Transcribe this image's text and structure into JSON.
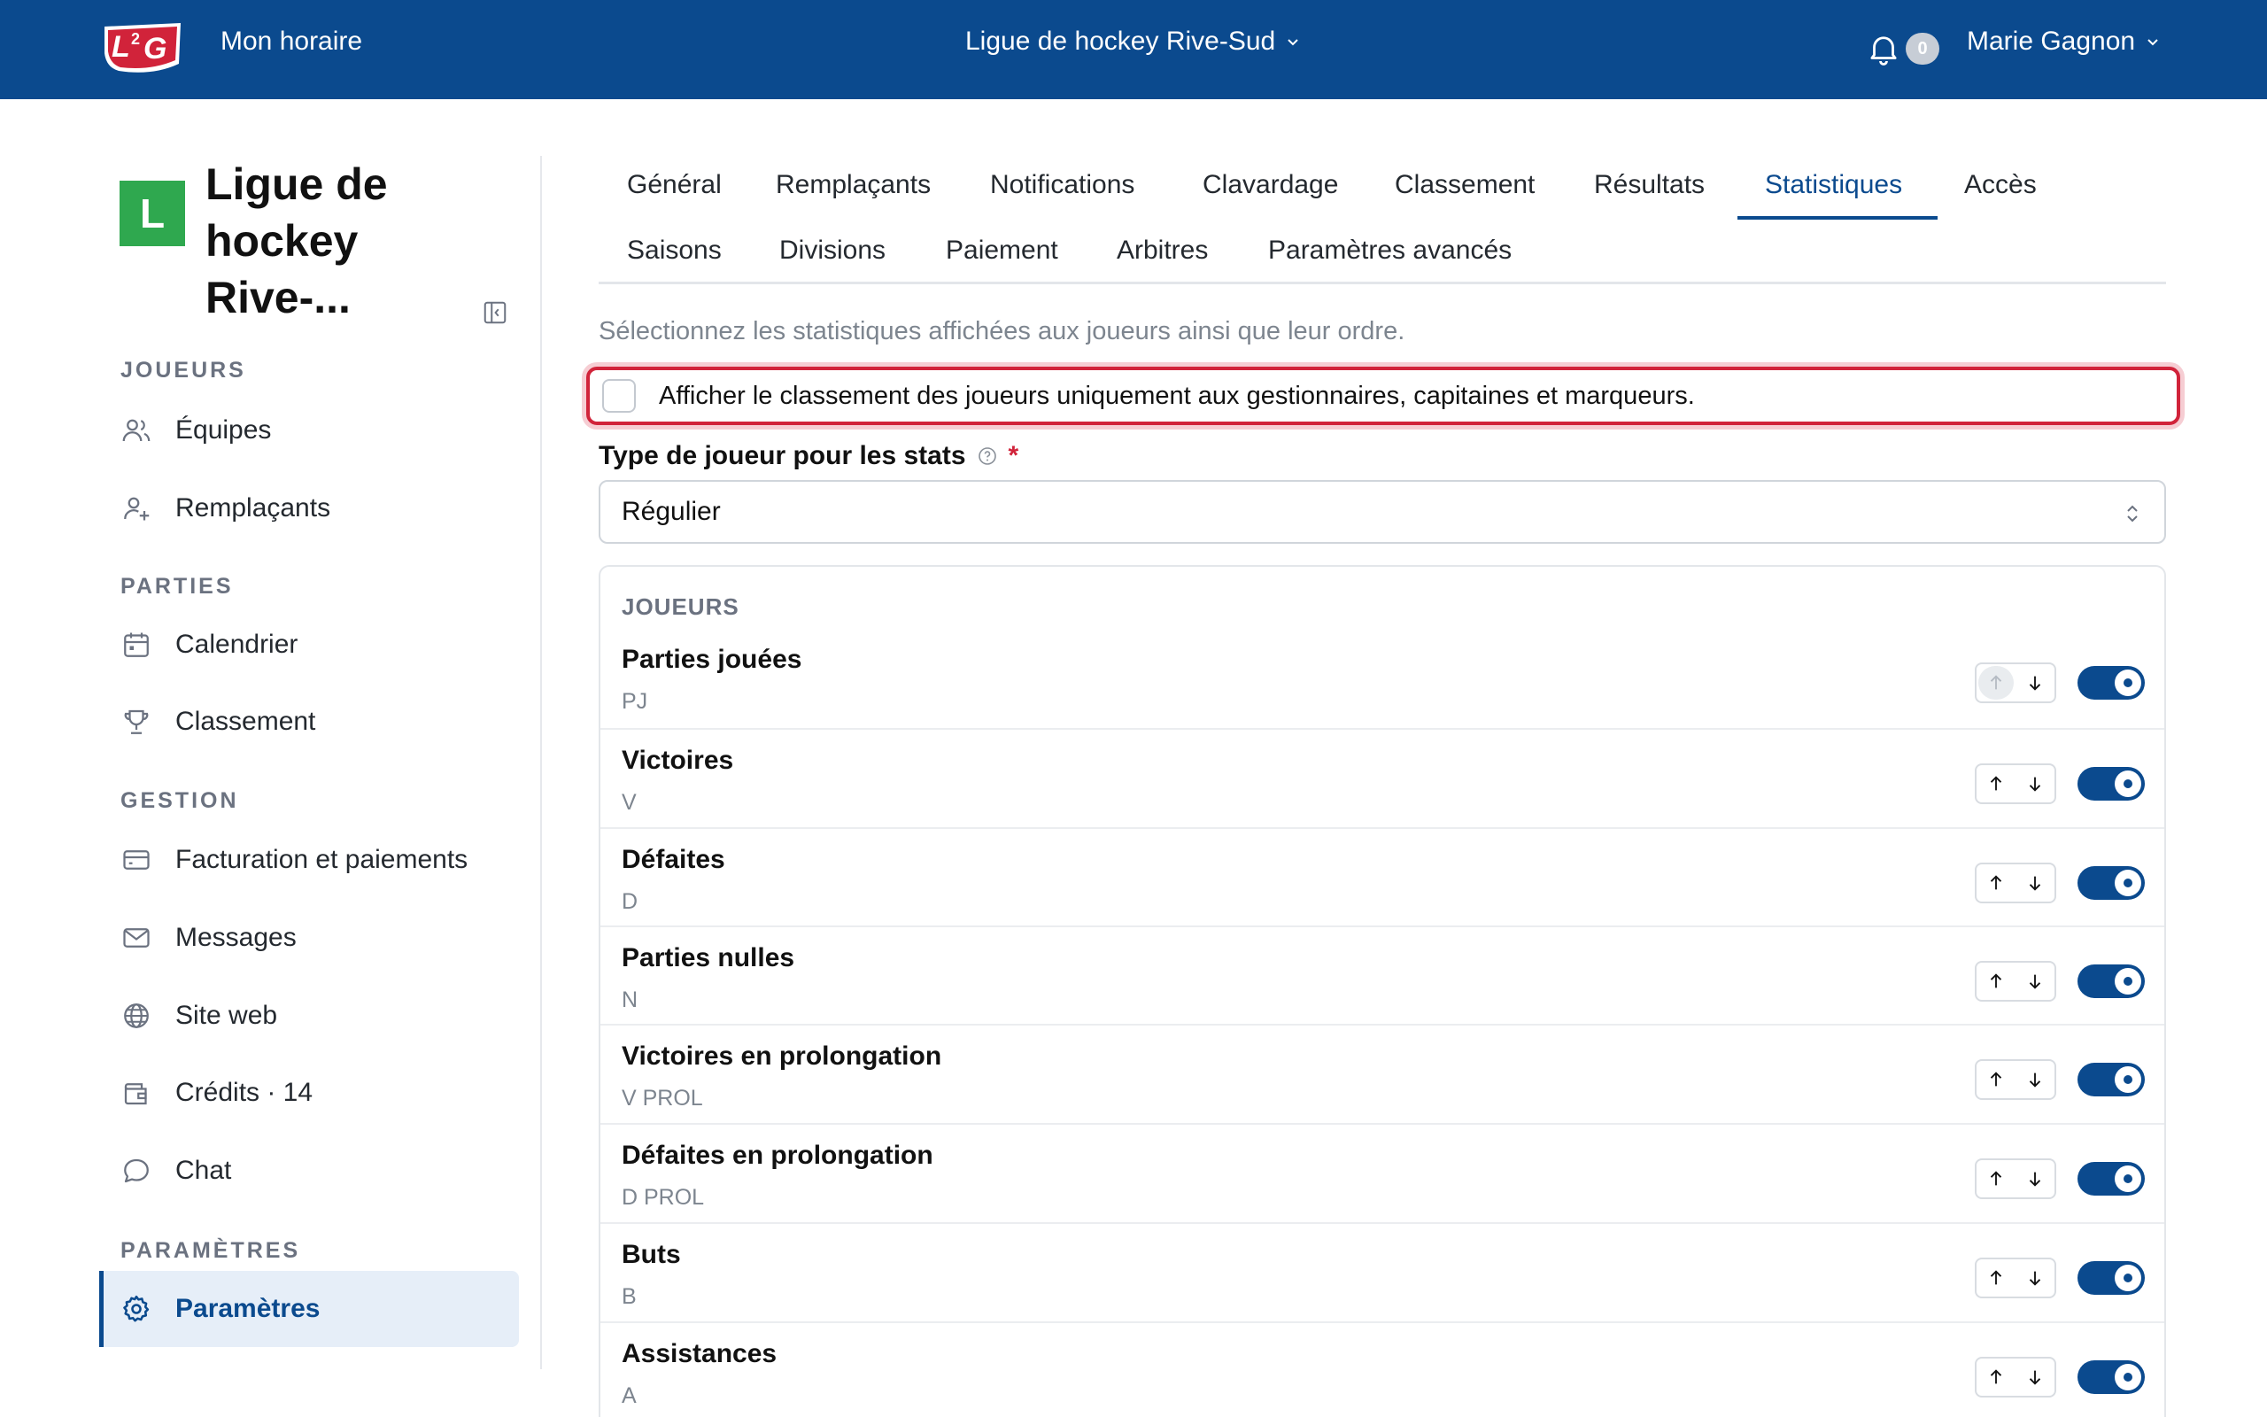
{
  "header": {
    "app_link": "Mon horaire",
    "league_selector": "Ligue de hockey Rive-Sud",
    "notification_count": "0",
    "user_name": "Marie Gagnon",
    "logo_text": "L2G"
  },
  "sidebar": {
    "org_initial": "L",
    "org_name": "Ligue de hockey Rive-...",
    "sections": {
      "joueurs": "JOUEURS",
      "parties": "PARTIES",
      "gestion": "GESTION",
      "parametres": "PARAMÈTRES"
    },
    "items": {
      "equipes": "Équipes",
      "remplacants": "Remplaçants",
      "calendrier": "Calendrier",
      "classement": "Classement",
      "facturation": "Facturation et paiements",
      "messages": "Messages",
      "site_web": "Site web",
      "credits": "Crédits · 14",
      "chat": "Chat",
      "parametres": "Paramètres"
    }
  },
  "tabs": {
    "row1": [
      "Général",
      "Remplaçants",
      "Notifications",
      "Clavardage",
      "Classement",
      "Résultats",
      "Statistiques",
      "Accès"
    ],
    "row2": [
      "Saisons",
      "Divisions",
      "Paiement",
      "Arbitres",
      "Paramètres avancés"
    ],
    "active": "Statistiques"
  },
  "content": {
    "hint": "Sélectionnez les statistiques affichées aux joueurs ainsi que leur ordre.",
    "checkbox_label": "Afficher le classement des joueurs uniquement aux gestionnaires, capitaines et marqueurs.",
    "checkbox_checked": false,
    "player_type_label": "Type de joueur pour les stats",
    "required_mark": "*",
    "player_type_value": "Régulier",
    "card_title": "JOUEURS",
    "stats": [
      {
        "name": "Parties jouées",
        "abbr": "PJ",
        "enabled": true,
        "up_disabled": true
      },
      {
        "name": "Victoires",
        "abbr": "V",
        "enabled": true,
        "up_disabled": false
      },
      {
        "name": "Défaites",
        "abbr": "D",
        "enabled": true,
        "up_disabled": false
      },
      {
        "name": "Parties nulles",
        "abbr": "N",
        "enabled": true,
        "up_disabled": false
      },
      {
        "name": "Victoires en prolongation",
        "abbr": "V PROL",
        "enabled": true,
        "up_disabled": false
      },
      {
        "name": "Défaites en prolongation",
        "abbr": "D PROL",
        "enabled": true,
        "up_disabled": false
      },
      {
        "name": "Buts",
        "abbr": "B",
        "enabled": true,
        "up_disabled": false
      },
      {
        "name": "Assistances",
        "abbr": "A",
        "enabled": true,
        "up_disabled": false
      }
    ]
  },
  "colors": {
    "brand": "#0b4a8e",
    "highlight": "#d1233a",
    "org_avatar": "#2fa84f"
  }
}
